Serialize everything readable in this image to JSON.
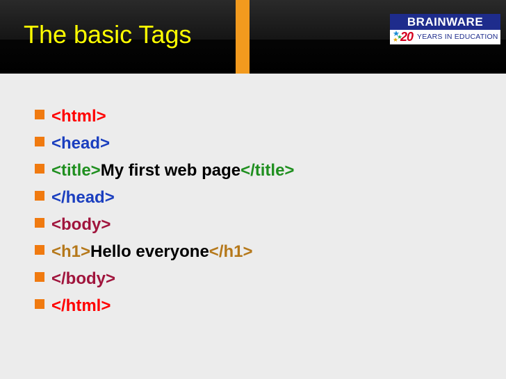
{
  "slide": {
    "title": "The basic Tags"
  },
  "logo": {
    "brand": "BRAINWARE",
    "number": "20",
    "tagline": "YEARS IN EDUCATION"
  },
  "icons": {
    "bullet": "square-bullet-icon",
    "logo_stars": "star-cluster-icon"
  },
  "colors": {
    "title": "#ffff00",
    "bullet": "#f07a10",
    "accent_bar": "#f29a1e",
    "html_tag": "#ff0000",
    "head_tag": "#1a3ebf",
    "title_tag": "#1f8f1f",
    "body_tag": "#a0143c",
    "h1_tag": "#b5781a",
    "plain_text": "#000000",
    "logo_blue": "#1e2c8c",
    "logo_red": "#d4001e"
  },
  "code_lines": [
    {
      "tag_open": "<html>",
      "text": "",
      "tag_close": "",
      "color": "#ff0000"
    },
    {
      "tag_open": "<head>",
      "text": "",
      "tag_close": "",
      "color": "#1a3ebf"
    },
    {
      "tag_open": "<title>",
      "text": "My first web page",
      "tag_close": "</title>",
      "color": "#1f8f1f"
    },
    {
      "tag_open": "</head>",
      "text": "",
      "tag_close": "",
      "color": "#1a3ebf"
    },
    {
      "tag_open": "<body>",
      "text": "",
      "tag_close": "",
      "color": "#a0143c"
    },
    {
      "tag_open": "<h1>",
      "text": "Hello everyone",
      "tag_close": "</h1>",
      "color": "#b5781a"
    },
    {
      "tag_open": "</body>",
      "text": "",
      "tag_close": "",
      "color": "#a0143c"
    },
    {
      "tag_open": "</html>",
      "text": "",
      "tag_close": "",
      "color": "#ff0000"
    }
  ]
}
